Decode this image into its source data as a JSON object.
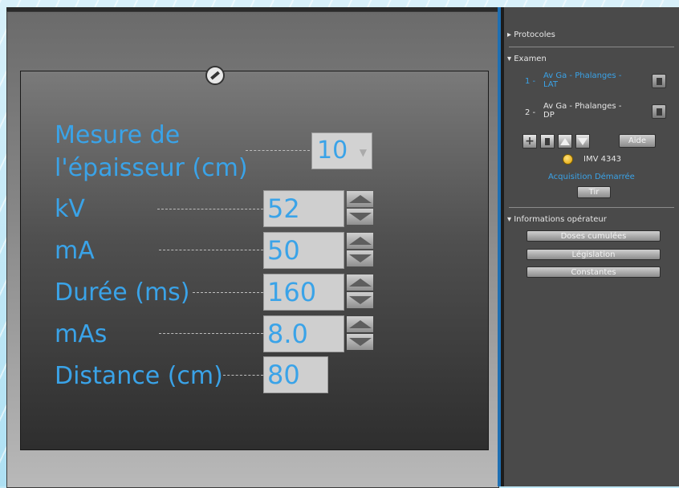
{
  "parameters": {
    "thickness": {
      "label_line1": "Mesure de",
      "label_line2": "l'épaisseur (cm)",
      "value": "10"
    },
    "kv": {
      "label": "kV",
      "value": "52"
    },
    "ma": {
      "label": "mA",
      "value": "50"
    },
    "duration": {
      "label": "Durée (ms)",
      "value": "160"
    },
    "mas": {
      "label": "mAs",
      "value": "8.0"
    },
    "distance": {
      "label": "Distance (cm)",
      "value": "80"
    }
  },
  "sidebar": {
    "protocols": {
      "label": "Protocoles"
    },
    "exam": {
      "label": "Examen",
      "items": [
        {
          "index": "1 -",
          "line1": "Av Ga - Phalanges -",
          "line2": "LAT",
          "color": "#3aa3e8"
        },
        {
          "index": "2 -",
          "line1": "Av Ga - Phalanges -",
          "line2": "DP",
          "color": "#e6e6e6"
        }
      ],
      "help_label": "Aide",
      "device": "IMV 4343",
      "status": "Acquisition Démarrée",
      "fire_label": "Tir"
    },
    "operator": {
      "label": "Informations opérateur",
      "buttons": [
        "Doses cumulées",
        "Législation",
        "Constantes"
      ]
    }
  },
  "colors": {
    "accent": "#3aa3e8",
    "panel": "#4a4a4a",
    "divider": "#1e6fb3"
  },
  "icons": {
    "measure": "ruler-icon",
    "add": "plus-icon",
    "delete": "trash-icon",
    "up": "arrow-up-icon",
    "down": "arrow-down-icon"
  }
}
